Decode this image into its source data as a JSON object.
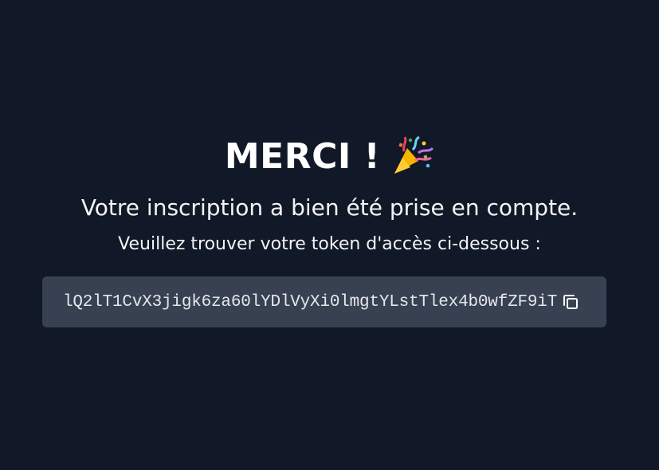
{
  "header": {
    "title": "MERCI !",
    "icon": "party-popper-icon"
  },
  "confirmation": {
    "message": "Votre inscription a bien été prise en compte.",
    "instruction": "Veuillez trouver votre token d'accès ci-dessous :"
  },
  "token": {
    "value": "lQ2lT1CvX3jigk6za60lYDlVyXi0lmgtYLstTlex4b0wfZF9iT",
    "copy_icon": "copy-icon"
  },
  "colors": {
    "background": "#111827",
    "token_box": "#374151",
    "text": "#ffffff"
  }
}
